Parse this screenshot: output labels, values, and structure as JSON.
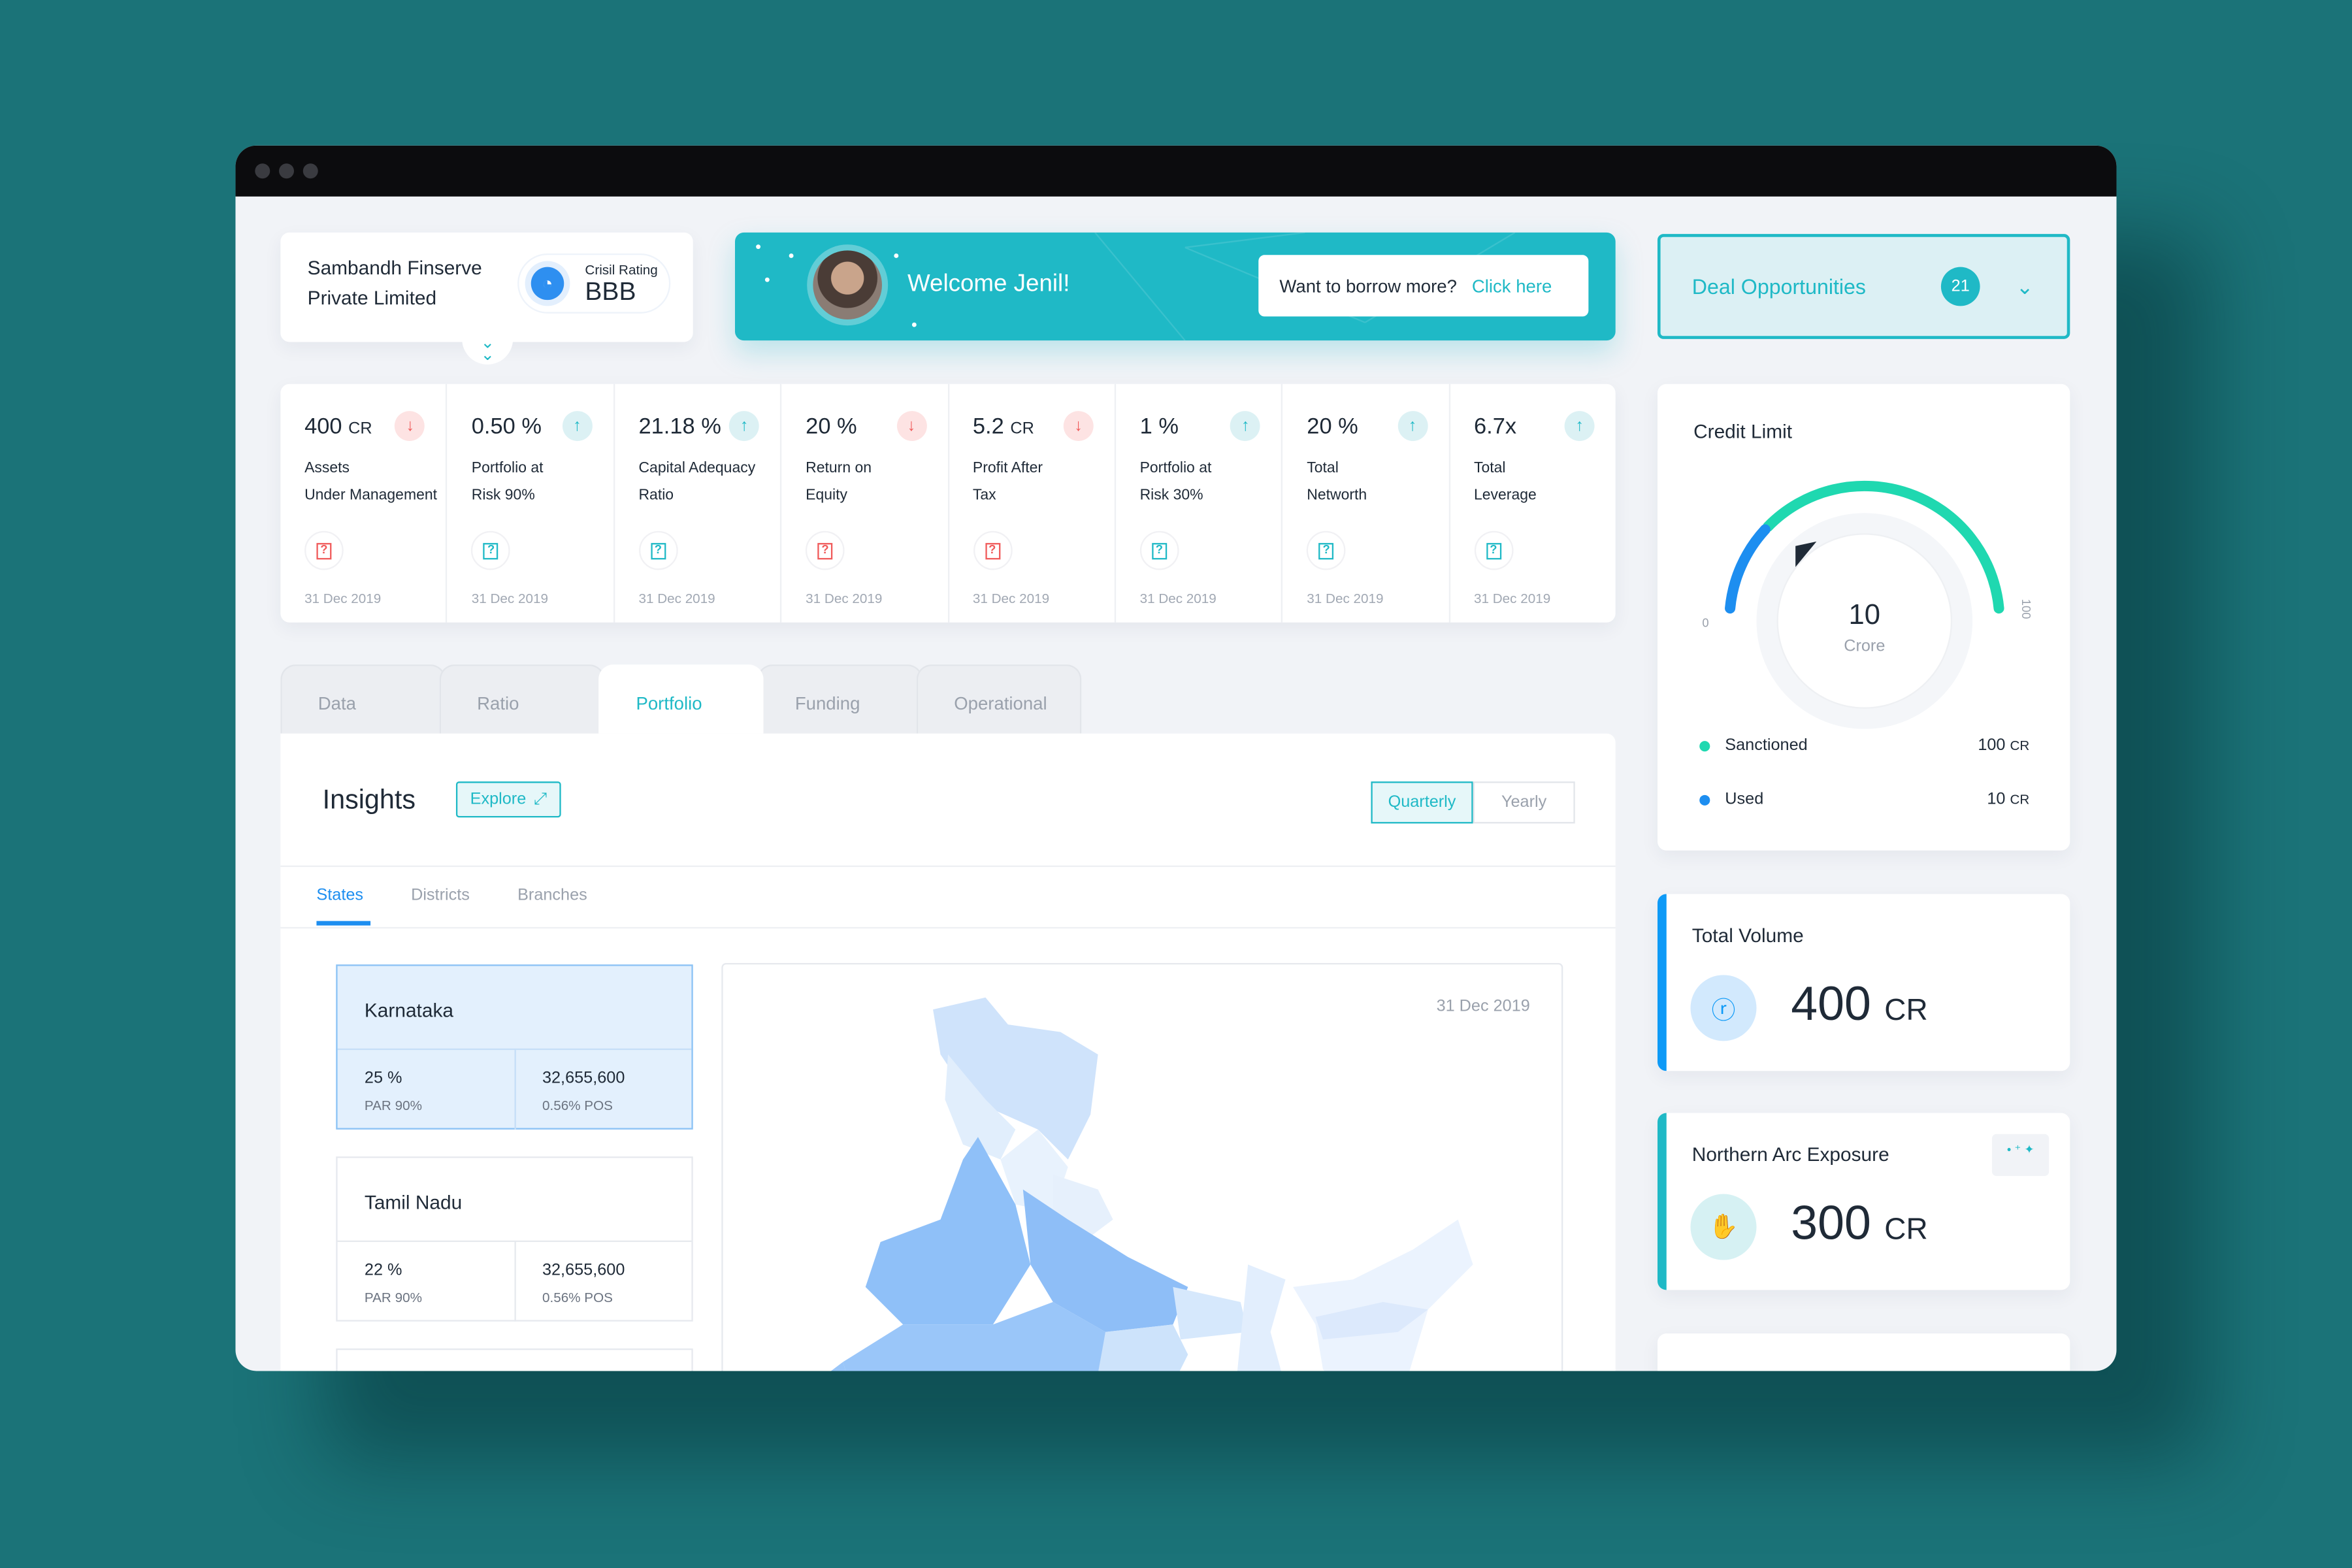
{
  "window": {
    "controls": [
      "close",
      "minimize",
      "maximize"
    ]
  },
  "company": {
    "name_line1": "Sambandh Finserve",
    "name_line2": "Private Limited",
    "rating_label": "Crisil Rating",
    "rating_value": "BBB"
  },
  "welcome": {
    "text": "Welcome Jenil!",
    "borrow_prompt": "Want to borrow more?",
    "borrow_link": "Click here"
  },
  "deal": {
    "label": "Deal Opportunities",
    "count": "21"
  },
  "kpis": [
    {
      "value": "400",
      "unit": "CR",
      "trend": "down",
      "label1": "Assets",
      "label2": "Under Management",
      "date": "31 Dec 2019"
    },
    {
      "value": "0.50 %",
      "unit": "",
      "trend": "up",
      "label1": "Portfolio at",
      "label2": "Risk 90%",
      "date": "31 Dec 2019"
    },
    {
      "value": "21.18 %",
      "unit": "",
      "trend": "up",
      "label1": "Capital Adequacy",
      "label2": "Ratio",
      "date": "31 Dec 2019"
    },
    {
      "value": "20 %",
      "unit": "",
      "trend": "down",
      "label1": "Return on",
      "label2": "Equity",
      "date": "31 Dec 2019"
    },
    {
      "value": "5.2",
      "unit": "CR",
      "trend": "down",
      "label1": "Profit After",
      "label2": "Tax",
      "date": "31 Dec 2019"
    },
    {
      "value": "1 %",
      "unit": "",
      "trend": "up",
      "label1": "Portfolio at",
      "label2": "Risk 30%",
      "date": "31 Dec 2019"
    },
    {
      "value": "20 %",
      "unit": "",
      "trend": "up",
      "label1": "Total",
      "label2": "Networth",
      "date": "31 Dec 2019"
    },
    {
      "value": "6.7x",
      "unit": "",
      "trend": "up",
      "label1": "Total",
      "label2": "Leverage",
      "date": "31 Dec 2019"
    }
  ],
  "tabs": [
    {
      "label": "Data"
    },
    {
      "label": "Ratio"
    },
    {
      "label": "Portfolio",
      "active": true
    },
    {
      "label": "Funding"
    },
    {
      "label": "Operational"
    }
  ],
  "insights": {
    "title": "Insights",
    "explore": "Explore",
    "period_options": [
      "Quarterly",
      "Yearly"
    ],
    "period_selected": "Quarterly",
    "subtabs": [
      "States",
      "Districts",
      "Branches"
    ],
    "subtab_selected": "States",
    "states": [
      {
        "name": "Karnataka",
        "par": "25 %",
        "par_label": "PAR 90%",
        "amount": "32,655,600",
        "pos": "0.56% POS",
        "selected": true
      },
      {
        "name": "Tamil Nadu",
        "par": "22 %",
        "par_label": "PAR 90%",
        "amount": "32,655,600",
        "pos": "0.56% POS"
      }
    ],
    "map_date": "31 Dec 2019"
  },
  "credit": {
    "title": "Credit Limit",
    "value": "10",
    "unit": "Crore",
    "min": "0",
    "max": "100",
    "used_fraction": 0.1,
    "legend": [
      {
        "label": "Sanctioned",
        "value": "100",
        "unit": "CR",
        "color": "#1fd8b0"
      },
      {
        "label": "Used",
        "value": "10",
        "unit": "CR",
        "color": "#1d8ef0"
      }
    ]
  },
  "total_volume": {
    "title": "Total Volume",
    "value": "400",
    "unit": "CR",
    "icon": "rupee-coin-icon",
    "color": "#0e9af7"
  },
  "exposure": {
    "title": "Northern Arc Exposure",
    "value": "300",
    "unit": "CR",
    "icon": "hand-rupee-icon",
    "color": "#1fb9c6"
  },
  "colors": {
    "accent": "#1fb9c6",
    "blue": "#1d8ef0",
    "down": "#f05a5a",
    "background": "#1b7378"
  }
}
